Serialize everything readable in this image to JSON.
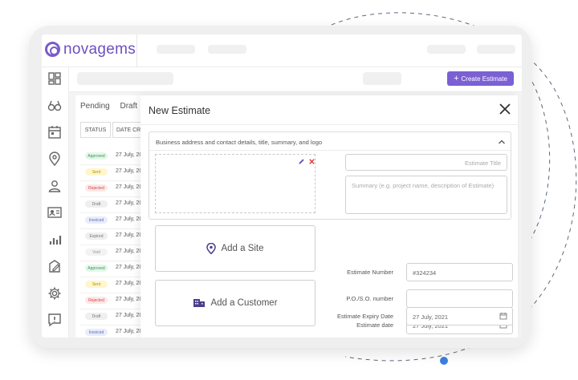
{
  "app": {
    "brand": "novagems",
    "create_button": "Create Estimate",
    "create_button_icon": "plus-icon"
  },
  "colors": {
    "brand": "#6d4fc2",
    "accent": "#7b5fd4",
    "decor_dot": "#3d7fe0"
  },
  "sidebar": {
    "icons": [
      "dashboard-icon",
      "binoculars-icon",
      "calendar-icon",
      "location-icon",
      "user-icon",
      "contact-card-icon",
      "bar-chart-icon",
      "edit-document-icon",
      "settings-icon",
      "feedback-icon"
    ]
  },
  "list": {
    "tabs": [
      "Pending",
      "Draft"
    ],
    "columns": [
      "STATUS",
      "DATE CRE"
    ],
    "rows": [
      {
        "status": "Approved",
        "date": "27 July, 20",
        "color": "#2e9e4f",
        "bg": "#e6f6ea"
      },
      {
        "status": "Sent",
        "date": "27 July, 20",
        "color": "#b58a00",
        "bg": "#fff6cc"
      },
      {
        "status": "Rejected",
        "date": "27 July, 20",
        "color": "#d64545",
        "bg": "#fde8e8"
      },
      {
        "status": "Draft",
        "date": "27 July, 20",
        "color": "#777777",
        "bg": "#efefef"
      },
      {
        "status": "Invoiced",
        "date": "27 July, 20",
        "color": "#5a6cc9",
        "bg": "#e9ecfb"
      },
      {
        "status": "Expired",
        "date": "27 July, 20",
        "color": "#777777",
        "bg": "#efefef"
      },
      {
        "status": "Void",
        "date": "27 July, 20",
        "color": "#999999",
        "bg": "#f3f3f3"
      },
      {
        "status": "Approved",
        "date": "27 July, 20",
        "color": "#2e9e4f",
        "bg": "#e6f6ea"
      },
      {
        "status": "Sent",
        "date": "27 July, 20",
        "color": "#b58a00",
        "bg": "#fff6cc"
      },
      {
        "status": "Rejected",
        "date": "27 July, 20",
        "color": "#d64545",
        "bg": "#fde8e8"
      },
      {
        "status": "Draft",
        "date": "27 July, 20",
        "color": "#777777",
        "bg": "#efefef"
      },
      {
        "status": "Invoiced",
        "date": "27 July, 20",
        "color": "#5a6cc9",
        "bg": "#e9ecfb"
      }
    ]
  },
  "modal": {
    "title": "New Estimate",
    "section_label": "Business address and contact details, title, summary, and logo",
    "estimate_title_placeholder": "Estimate Title",
    "summary_placeholder": "Summary (e.g. project name, description of Estimate)",
    "add_site": "Add a Site",
    "add_customer": "Add a Customer",
    "fields": {
      "estimate_number_label": "Estimate Number",
      "estimate_number_value": "#324234",
      "po_label": "P.O./S.O. number",
      "estimate_date_label": "Estimate date",
      "estimate_date_value": "27 July, 2021",
      "expiry_label": "Estimate Expiry Date",
      "expiry_value": "27 July, 2021"
    }
  }
}
